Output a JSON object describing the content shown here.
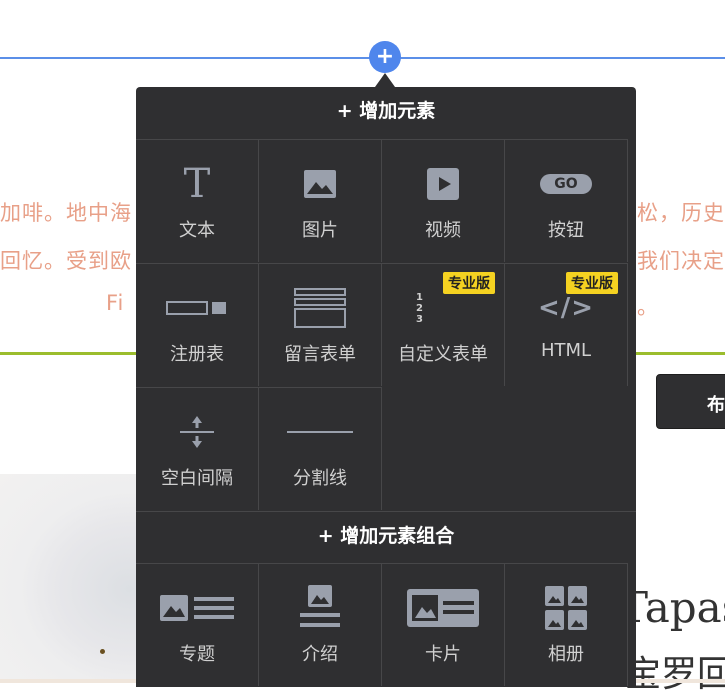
{
  "background": {
    "text_lines": [
      "加啡。地中海",
      "松，历史",
      "回忆。受到欧",
      "我们决定",
      "Fi",
      "。"
    ],
    "button_label": "布",
    "serif_lines": [
      "Tapas",
      "宝罗回"
    ]
  },
  "add_button": {
    "symbol": "+"
  },
  "panel": {
    "elements_title": "+ 增加元素",
    "elements": [
      {
        "label": "文本",
        "icon": "text-icon",
        "glyph": "T"
      },
      {
        "label": "图片",
        "icon": "image-icon"
      },
      {
        "label": "视频",
        "icon": "video-icon"
      },
      {
        "label": "按钮",
        "icon": "button-icon",
        "glyph": "GO"
      },
      {
        "label": "注册表",
        "icon": "signup-form-icon"
      },
      {
        "label": "留言表单",
        "icon": "message-form-icon"
      },
      {
        "label": "自定义表单",
        "icon": "custom-form-icon",
        "badge": "专业版",
        "digits": [
          "1",
          "2",
          "3"
        ]
      },
      {
        "label": "HTML",
        "icon": "html-icon",
        "badge": "专业版",
        "glyph": "</>"
      },
      {
        "label": "空白间隔",
        "icon": "spacer-icon"
      },
      {
        "label": "分割线",
        "icon": "divider-icon"
      }
    ],
    "groups_title": "+ 增加元素组合",
    "groups": [
      {
        "label": "专题",
        "icon": "feature-icon"
      },
      {
        "label": "介绍",
        "icon": "intro-icon"
      },
      {
        "label": "卡片",
        "icon": "card-icon"
      },
      {
        "label": "相册",
        "icon": "gallery-icon"
      }
    ]
  },
  "colors": {
    "panel_bg": "#2f2f31",
    "accent_blue": "#4f86ec",
    "badge_yellow": "#f5d221",
    "icon_gray": "#9aa0ac",
    "bg_text": "#e8a088",
    "green_line": "#9bbd2d"
  }
}
